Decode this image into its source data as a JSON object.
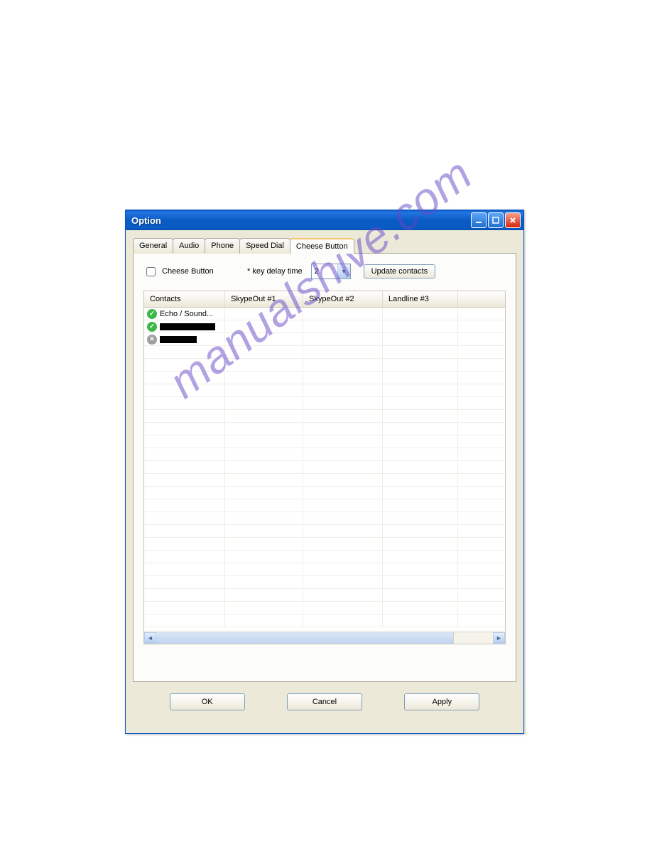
{
  "window": {
    "title": "Option"
  },
  "tabs": [
    "General",
    "Audio",
    "Phone",
    "Speed Dial",
    "Cheese Button"
  ],
  "active_tab": "Cheese Button",
  "cheese": {
    "checkbox_label": "Cheese Button",
    "key_delay_label": "* key delay time",
    "key_delay_value": "2",
    "update_btn": "Update contacts"
  },
  "grid": {
    "headers": [
      "Contacts",
      "SkypeOut #1",
      "SkypeOut #2",
      "Landline #3"
    ],
    "rows": [
      {
        "status": "on",
        "name": "Echo / Sound..."
      },
      {
        "status": "on",
        "name": "████████████"
      },
      {
        "status": "off",
        "name": "████████"
      }
    ]
  },
  "footer": {
    "ok": "OK",
    "cancel": "Cancel",
    "apply": "Apply"
  },
  "watermark": "manualshive.com"
}
